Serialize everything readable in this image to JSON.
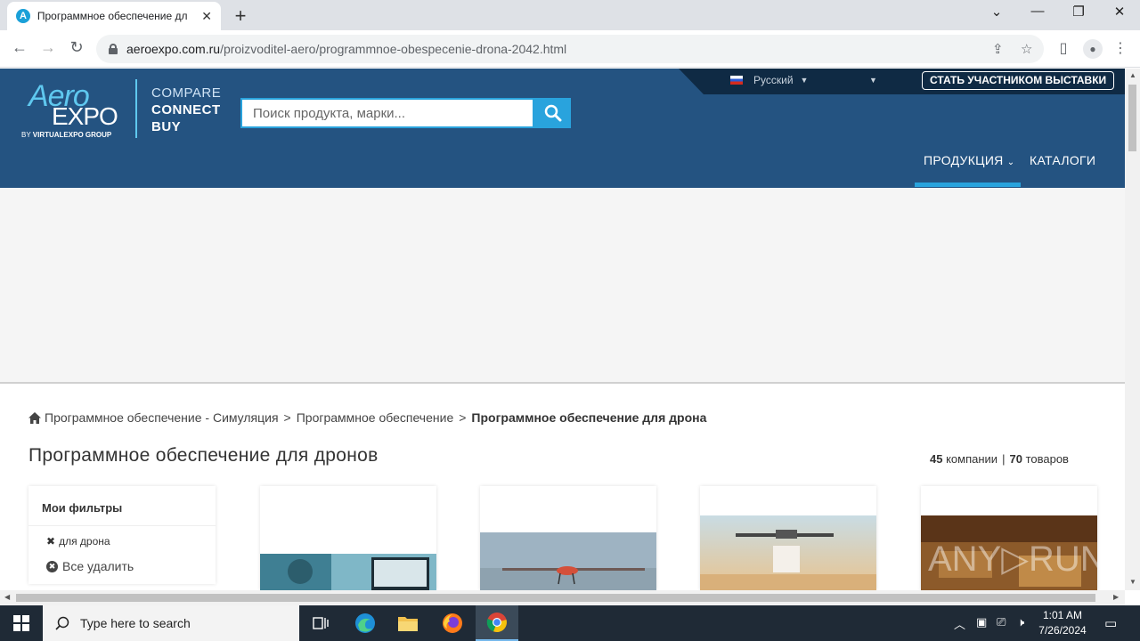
{
  "browser": {
    "tab_title": "Программное обеспечение дл",
    "tab_favicon": "A",
    "url_domain": "aeroexpo.com.ru",
    "url_path": "/proizvoditel-aero/programmnoe-obespecenie-drona-2042.html"
  },
  "header": {
    "language": "Русский",
    "exhibitor_button": "СТАТЬ УЧАСТНИКОМ ВЫСТАВКИ",
    "logo": {
      "aero": "Aero",
      "expo": "EXPO",
      "by": "BY",
      "group": "VIRTUALEXPO GROUP",
      "tagline": [
        "COMPARE",
        "CONNECT",
        "BUY"
      ]
    },
    "search_placeholder": "Поиск продукта, марки...",
    "nav": [
      "ПРОДУКЦИЯ",
      "КАТАЛОГИ"
    ],
    "accent_color": "#29a3dd",
    "bg_color": "#245381"
  },
  "breadcrumb": {
    "items": [
      "Программное обеспечение - Симуляция",
      "Программное обеспечение"
    ],
    "current": "Программное обеспечение для дрона"
  },
  "page_title": "Программное обеспечение для дронов",
  "counts": {
    "companies_num": "45",
    "companies_label": "компании",
    "products_num": "70",
    "products_label": "товаров"
  },
  "filters": {
    "title": "Мои фильтры",
    "active": "для дрона",
    "clear_all": "Все удалить"
  },
  "taskbar": {
    "search_text": "Type here to search",
    "time": "1:01 AM",
    "date": "7/26/2024"
  }
}
